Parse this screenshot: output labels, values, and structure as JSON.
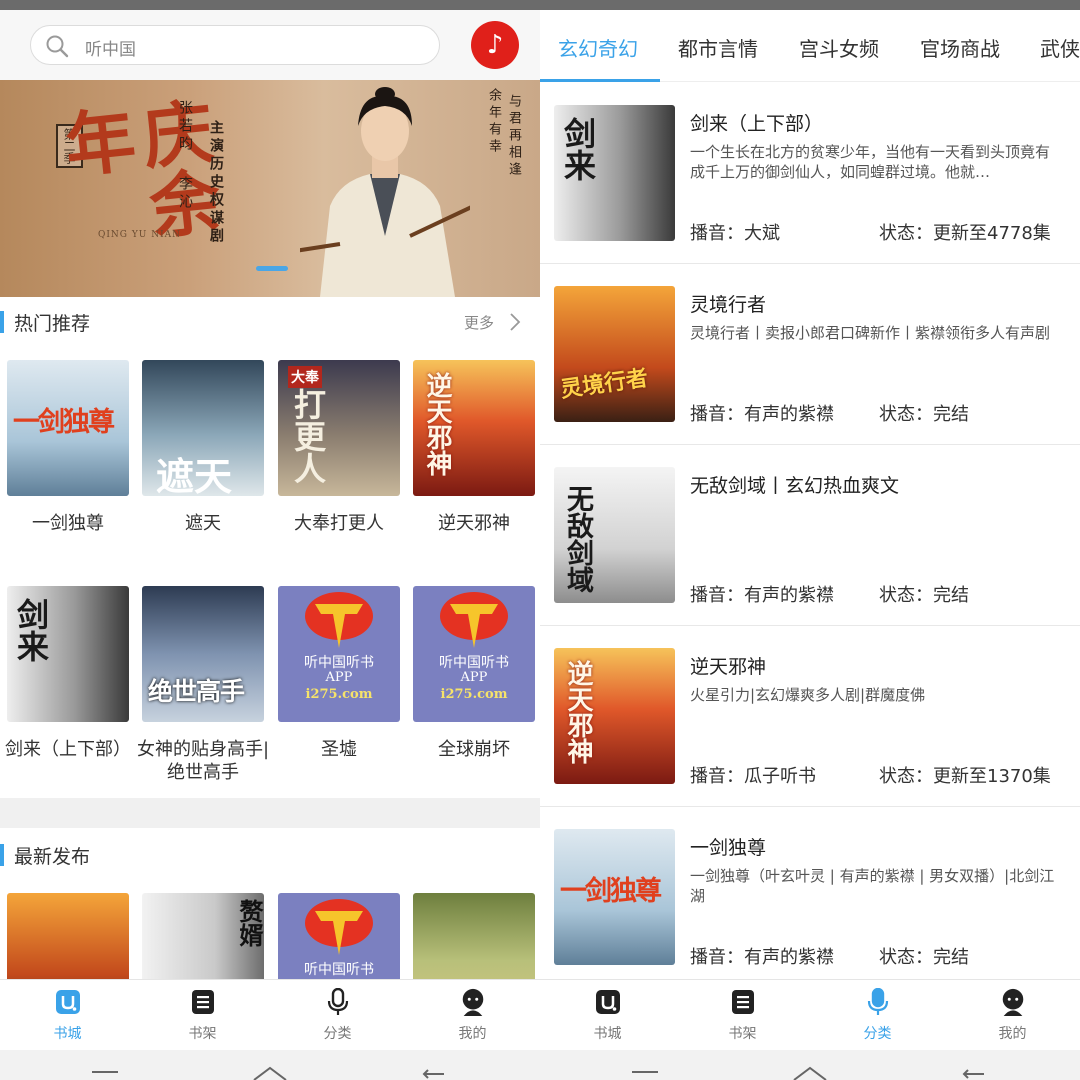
{
  "left": {
    "search": {
      "placeholder": "听中国"
    },
    "banner": {
      "title": "庆余年",
      "season": "第二季",
      "line_actor": "张若昀",
      "line_role": "李沁",
      "line_role_desc": "主演历史权谋剧",
      "poem_1": "余年有幸",
      "poem_2": "与君再相逢",
      "pinyin": "QING YU NIAN"
    },
    "hot": {
      "title": "热门推荐",
      "more": "更多",
      "books": [
        {
          "title": "一剑独尊",
          "cover_text": "一剑独尊"
        },
        {
          "title": "遮天",
          "cover_text": "遮天"
        },
        {
          "title": "大奉打更人",
          "cover_text": "打更人",
          "cover_tag": "大奉"
        },
        {
          "title": "逆天邪神",
          "cover_text": "逆天邪神"
        },
        {
          "title": "剑来（上下部）",
          "cover_text": "剑来"
        },
        {
          "title": "女神的贴身高手|绝世高手",
          "cover_text": "绝世高手"
        },
        {
          "title": "圣墟",
          "cover_text": "听中国听书",
          "cover_sub": "APP",
          "cover_url": "i275.com"
        },
        {
          "title": "全球崩坏",
          "cover_text": "听中国听书",
          "cover_sub": "APP",
          "cover_url": "i275.com"
        }
      ]
    },
    "latest": {
      "title": "最新发布",
      "books": [
        {
          "cover_text": ""
        },
        {
          "cover_text": "赘婿"
        },
        {
          "cover_text": "听中国听书"
        },
        {
          "cover_text": ""
        }
      ]
    },
    "tabbar": [
      {
        "label": "书城",
        "icon": "bookstore-icon"
      },
      {
        "label": "书架",
        "icon": "bookshelf-icon"
      },
      {
        "label": "分类",
        "icon": "microphone-icon"
      },
      {
        "label": "我的",
        "icon": "profile-icon"
      }
    ]
  },
  "right": {
    "categories": [
      "玄幻奇幻",
      "都市言情",
      "宫斗女频",
      "官场商战",
      "武侠"
    ],
    "list": [
      {
        "title": "剑来（上下部）",
        "desc": "一个生长在北方的贫寒少年，当他有一天看到头顶竟有成千上万的御剑仙人，如同蝗群过境。他就…",
        "narrator_label": "播音：",
        "narrator": "大斌",
        "status_label": "状态：",
        "status": "更新至4778集",
        "cover_text": "剑来"
      },
      {
        "title": "灵境行者",
        "desc": "灵境行者丨卖报小郎君口碑新作丨紫襟领衔多人有声剧",
        "narrator_label": "播音：",
        "narrator": "有声的紫襟",
        "status_label": "状态：",
        "status": "完结",
        "cover_text": "灵境行者"
      },
      {
        "title": "无敌剑域丨玄幻热血爽文",
        "desc": "",
        "narrator_label": "播音：",
        "narrator": "有声的紫襟",
        "status_label": "状态：",
        "status": "完结",
        "cover_text": "无敌剑域"
      },
      {
        "title": "逆天邪神",
        "desc": "火星引力|玄幻爆爽多人剧|群魔度佛",
        "narrator_label": "播音：",
        "narrator": "瓜子听书",
        "status_label": "状态：",
        "status": "更新至1370集",
        "cover_text": "逆天邪神"
      },
      {
        "title": "一剑独尊",
        "desc": "一剑独尊（叶玄叶灵 | 有声的紫襟 | 男女双播）|北剑江湖",
        "narrator_label": "播音：",
        "narrator": "有声的紫襟",
        "status_label": "状态：",
        "status": "完结",
        "cover_text": "一剑独尊"
      }
    ],
    "tabbar": [
      {
        "label": "书城",
        "icon": "bookstore-icon"
      },
      {
        "label": "书架",
        "icon": "bookshelf-icon"
      },
      {
        "label": "分类",
        "icon": "microphone-icon"
      },
      {
        "label": "我的",
        "icon": "profile-icon"
      }
    ]
  },
  "colors": {
    "accent": "#3aa2e8",
    "music_button": "#e0201a",
    "tab_inactive": "#777777"
  }
}
